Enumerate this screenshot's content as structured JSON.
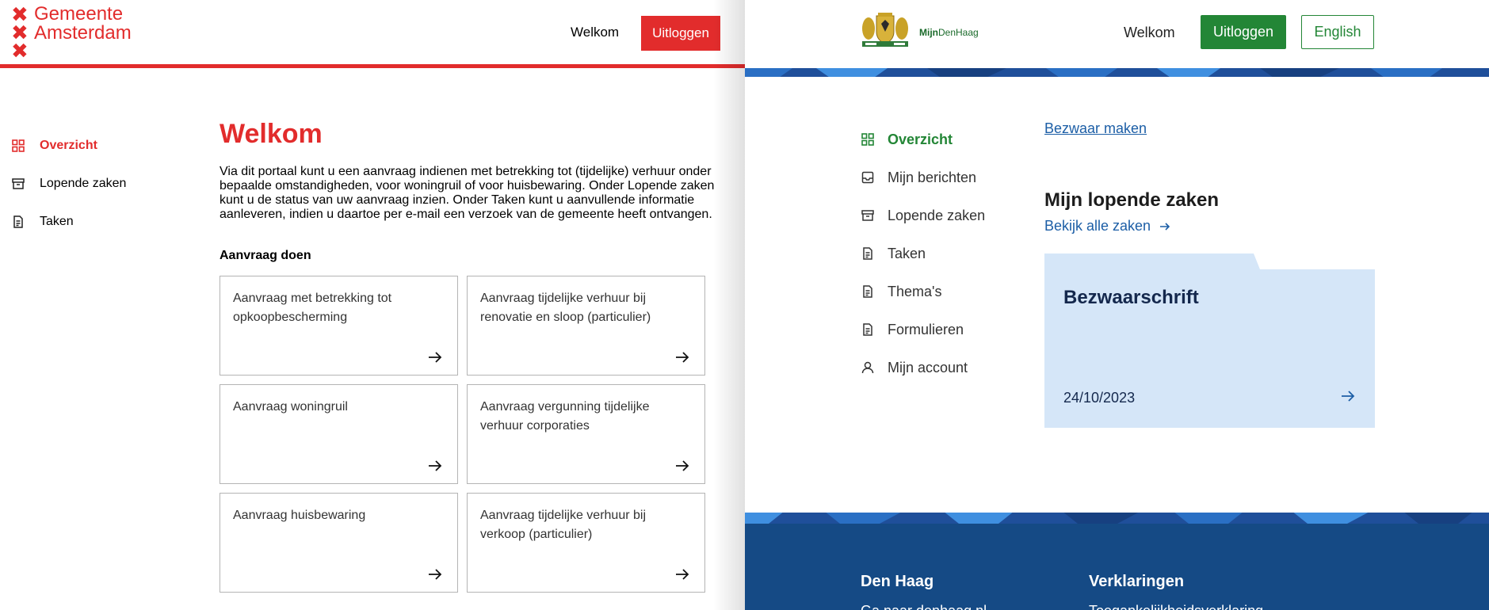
{
  "amsterdam": {
    "logo": {
      "line1": "Gemeente",
      "line2": "Amsterdam"
    },
    "header": {
      "welcome": "Welkom",
      "logout": "Uitloggen"
    },
    "nav": [
      {
        "label": "Overzicht",
        "icon": "grid-icon",
        "active": true
      },
      {
        "label": "Lopende zaken",
        "icon": "archive-icon",
        "active": false
      },
      {
        "label": "Taken",
        "icon": "document-icon",
        "active": false
      }
    ],
    "main": {
      "title": "Welkom",
      "intro": "Via dit portaal kunt u een aanvraag indienen met betrekking tot (tijdelijke) verhuur onder bepaalde omstandigheden, voor woningruil of voor huisbewaring. Onder Lopende zaken kunt u de status van uw aanvraag inzien. Onder Taken kunt u aanvullende informatie aanleveren, indien u daartoe per e-mail een verzoek van de gemeente heeft ontvangen.",
      "subtitle": "Aanvraag doen",
      "cards": [
        "Aanvraag met betrekking tot opkoopbescherming",
        "Aanvraag tijdelijke verhuur bij renovatie en sloop (particulier)",
        "Aanvraag woningruil",
        "Aanvraag vergunning tijdelijke verhuur corporaties",
        "Aanvraag huisbewaring",
        "Aanvraag tijdelijke verhuur bij verkoop (particulier)"
      ]
    },
    "colors": {
      "brand": "#e22c2c"
    }
  },
  "denhaag": {
    "brand": {
      "prefix": "Mijn",
      "name": "DenHaag"
    },
    "header": {
      "welcome": "Welkom",
      "logout": "Uitloggen",
      "language": "English"
    },
    "nav": [
      {
        "label": "Overzicht",
        "icon": "grid-icon",
        "active": true
      },
      {
        "label": "Mijn berichten",
        "icon": "inbox-icon",
        "active": false
      },
      {
        "label": "Lopende zaken",
        "icon": "archive-icon",
        "active": false
      },
      {
        "label": "Taken",
        "icon": "document-icon",
        "active": false
      },
      {
        "label": "Thema's",
        "icon": "document-icon",
        "active": false
      },
      {
        "label": "Formulieren",
        "icon": "document-icon",
        "active": false
      },
      {
        "label": "Mijn account",
        "icon": "user-icon",
        "active": false
      }
    ],
    "content": {
      "bezwaar_link": "Bezwaar maken",
      "section_title": "Mijn lopende zaken",
      "all_cases_link": "Bekijk alle zaken",
      "case": {
        "title": "Bezwaarschrift",
        "date": "24/10/2023"
      }
    },
    "footer": {
      "col1_title": "Den Haag",
      "col1_link": "Ga naar denhaag.nl",
      "col2_title": "Verklaringen",
      "col2_link": "Toegankelijkheidsverklaring"
    },
    "colors": {
      "brand": "#238636",
      "link": "#1c5ea6",
      "footer": "#154a85",
      "folder": "#d5e6f8"
    }
  }
}
